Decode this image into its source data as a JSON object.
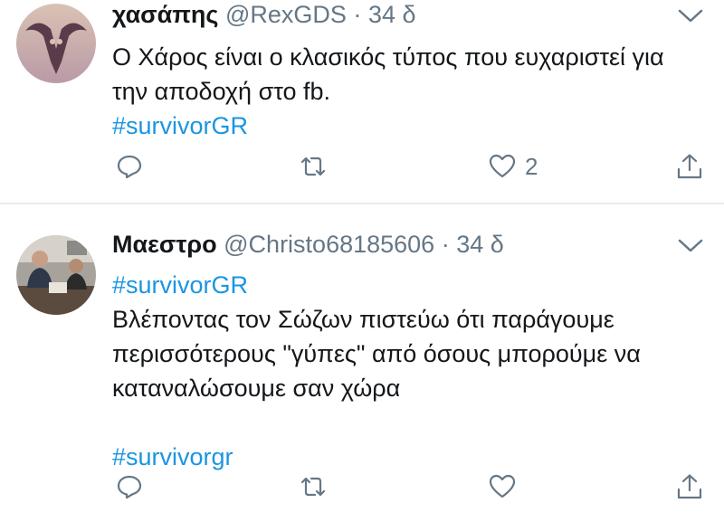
{
  "tweets": [
    {
      "name": "χασάπης",
      "handle": "@RexGDS",
      "separator": "·",
      "time": "34 δ",
      "text_lines": [
        "Ο Χάρος είναι ο κλασικός τύπος που ευχαριστεί για",
        "την αποδοχή στο fb."
      ],
      "hashtags": [
        "#survivorGR"
      ],
      "likes": "2"
    },
    {
      "name": "Μαεστρο",
      "handle": "@Christo68185606",
      "separator": "·",
      "time": "34 δ",
      "hashtag_top": "#survivorGR",
      "text_lines": [
        "Βλέποντας τον Σώζων πιστεύω ότι παράγουμε",
        "περισσότερους \"γύπες\" από όσους μπορούμε να",
        "καταναλώσουμε σαν χώρα"
      ],
      "hashtag_bottom": "#survivorgr"
    }
  ],
  "icons": {
    "reply": "reply-icon",
    "retweet": "retweet-icon",
    "like": "heart-icon",
    "share": "share-icon",
    "menu": "chevron-down-icon"
  },
  "colors": {
    "text": "#14171a",
    "muted": "#657786",
    "link": "#1b95e0",
    "divider": "#e6ecf0"
  }
}
